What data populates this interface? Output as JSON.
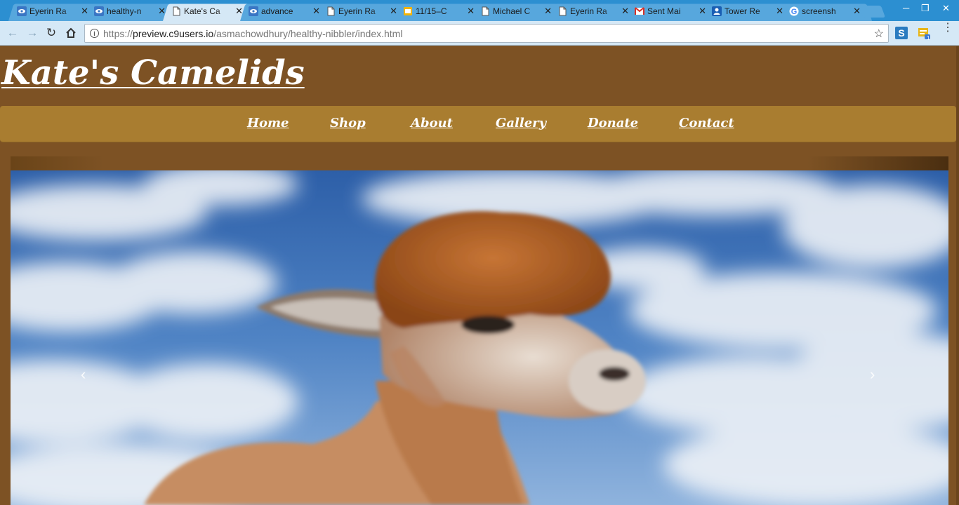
{
  "browser": {
    "tabs": [
      {
        "title": "Eyerin Ra",
        "icon": "eye-icon",
        "active": false
      },
      {
        "title": "healthy-n",
        "icon": "eye-icon",
        "active": false
      },
      {
        "title": "Kate's Ca",
        "icon": "document-icon",
        "active": true
      },
      {
        "title": "advance",
        "icon": "eye-icon",
        "active": false
      },
      {
        "title": "Eyerin Ra",
        "icon": "document-icon",
        "active": false
      },
      {
        "title": "11/15–C",
        "icon": "slides-icon",
        "active": false
      },
      {
        "title": "Michael C",
        "icon": "document-icon",
        "active": false
      },
      {
        "title": "Eyerin Ra",
        "icon": "document-icon",
        "active": false
      },
      {
        "title": "Sent Mai",
        "icon": "gmail-icon",
        "active": false
      },
      {
        "title": "Tower Re",
        "icon": "contact-icon",
        "active": false
      },
      {
        "title": "screensh",
        "icon": "google-icon",
        "active": false
      }
    ],
    "url_scheme": "https://",
    "url_host": "preview.c9users.io",
    "url_path": "/asmachowdhury/healthy-nibbler/index.html",
    "extension_badge": "1"
  },
  "site": {
    "title": "Kate's Camelids",
    "nav": [
      "Home",
      "Shop",
      "About",
      "Gallery",
      "Donate",
      "Contact"
    ],
    "carousel": {
      "prev": "‹",
      "next": "›"
    }
  },
  "colors": {
    "page_bg": "#7d5224",
    "navbar_bg": "#a97d30",
    "tabstrip": "#2c8fd1",
    "toolbar": "#d5e8f6"
  }
}
